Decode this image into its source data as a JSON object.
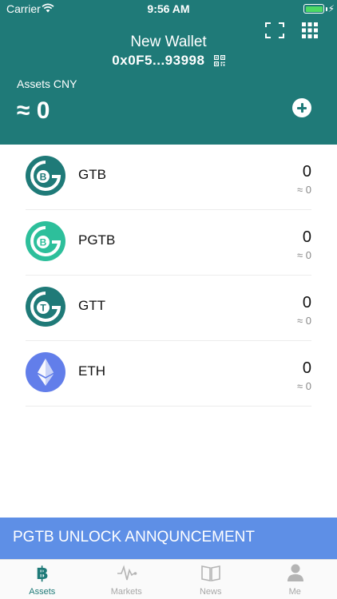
{
  "status_bar": {
    "carrier": "Carrier",
    "time": "9:56 AM"
  },
  "header": {
    "wallet_name": "New Wallet",
    "wallet_address": "0x0F5...93998",
    "assets_label": "Assets CNY",
    "assets_total": "≈ 0",
    "icons": [
      "scan-icon",
      "grid-icon",
      "qr-code-icon",
      "add-icon"
    ]
  },
  "tokens": [
    {
      "symbol": "GTB",
      "balance": "0",
      "value": "≈ 0",
      "logo_letter": "B",
      "color": "#1f7a78"
    },
    {
      "symbol": "PGTB",
      "balance": "0",
      "value": "≈ 0",
      "logo_letter": "B",
      "color": "#2dbf9b"
    },
    {
      "symbol": "GTT",
      "balance": "0",
      "value": "≈ 0",
      "logo_letter": "T",
      "color": "#1f7a78"
    },
    {
      "symbol": "ETH",
      "balance": "0",
      "value": "≈ 0",
      "logo_letter": "",
      "color": "#627eea"
    }
  ],
  "announcement": {
    "text": "PGTB UNLOCK ANNQUNCEMENT"
  },
  "tabs": [
    {
      "label": "Assets",
      "icon": "bitcoin-icon",
      "active": true
    },
    {
      "label": "Markets",
      "icon": "pulse-icon",
      "active": false
    },
    {
      "label": "News",
      "icon": "book-icon",
      "active": false
    },
    {
      "label": "Me",
      "icon": "person-icon",
      "active": false
    }
  ],
  "colors": {
    "primary": "#1f7a78",
    "secondary": "#2dbf9b",
    "eth": "#627eea",
    "banner": "#5e8fe6"
  }
}
